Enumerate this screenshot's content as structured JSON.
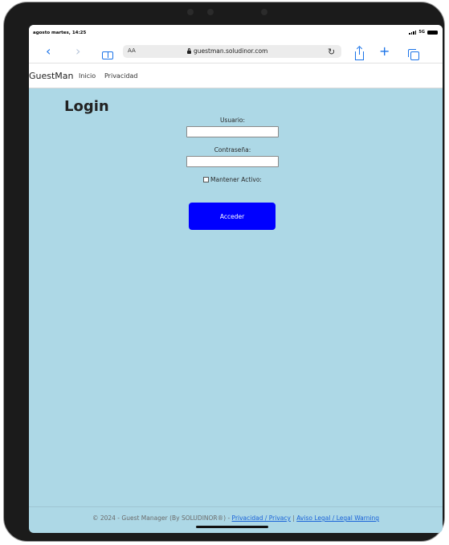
{
  "status": {
    "time": "agosto martes, 14:25",
    "network": "5G"
  },
  "browser": {
    "text_size": "AA",
    "url": "guestman.soludinor.com",
    "icons": [
      "chevron-left-icon",
      "chevron-right-icon",
      "bookmarks-icon",
      "lock-icon",
      "reload-icon",
      "share-icon",
      "plus-icon",
      "tabs-icon"
    ]
  },
  "nav": {
    "brand": "GuestMan",
    "links": [
      "Inicio",
      "Privacidad"
    ]
  },
  "login": {
    "title": "Login",
    "username_label": "Usuario:",
    "password_label": "Contraseña:",
    "keep_active_label": "Mantener Activo:",
    "submit": "Acceder"
  },
  "footer": {
    "copyright": "© 2024 - Guest Manager (By SOLUDINOR®) -",
    "privacy": "Privacidad / Privacy",
    "separator": "|",
    "legal": "Aviso Legal / Legal Warning"
  },
  "colors": {
    "page_bg": "#add8e6",
    "button": "#0000ff",
    "link": "#1a73e8"
  }
}
